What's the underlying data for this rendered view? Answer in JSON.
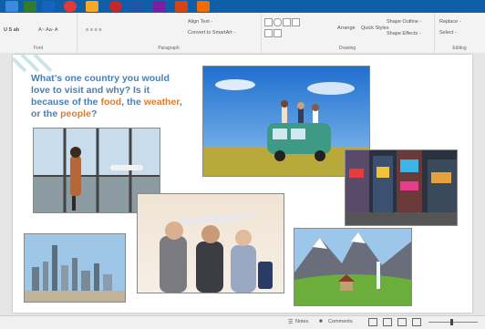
{
  "ribbon": {
    "font_group": "Font",
    "paragraph_group": "Paragraph",
    "drawing_group": "Drawing",
    "editing_group": "Editing",
    "align_text": "Align Text -",
    "convert_smartart": "Convert to SmartArt -",
    "arrange": "Arrange",
    "quick_styles": "Quick Styles",
    "shape_outline": "Shape Outline -",
    "shape_effects": "Shape Effects -",
    "replace": "Replace -",
    "select": "Select -"
  },
  "slide": {
    "prompt_lines": {
      "l1": "What’s one country you would",
      "l2": "love to visit and why? Is it",
      "l3a": "because of the ",
      "food": "food",
      "sep1": ", the ",
      "weather": "weather",
      "sep2": ",",
      "l4a": "or the ",
      "people": "people",
      "l4b": "?"
    }
  },
  "status": {
    "notes": "Notes",
    "comments": "Comments"
  },
  "colors": {
    "prompt_blue": "#4a7fb5",
    "prompt_orange": "#e07b2a",
    "taskbar": "#0e5ea8"
  }
}
